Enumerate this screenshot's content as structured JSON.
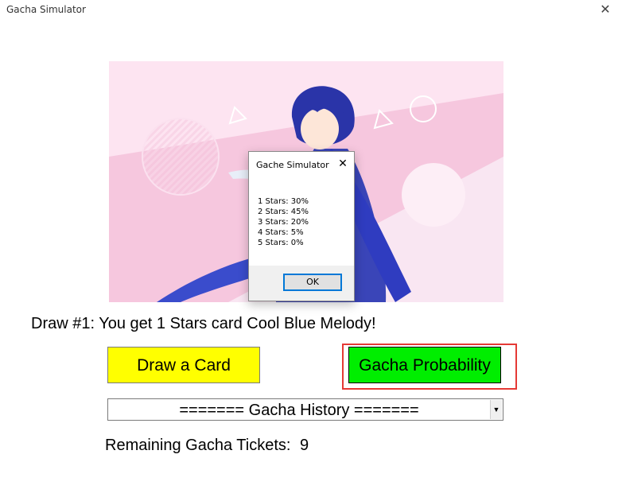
{
  "window": {
    "title": "Gacha Simulator",
    "close_glyph": "✕"
  },
  "banner": {
    "image": "character-banner-pink-background"
  },
  "dialog": {
    "title": "Gache Simulator",
    "close_glyph": "✕",
    "lines": [
      "1 Stars: 30%",
      "2 Stars: 45%",
      "3 Stars: 20%",
      "4 Stars: 5%",
      "5 Stars: 0%"
    ],
    "ok_label": "OK"
  },
  "main": {
    "draw_result": "Draw #1: You get 1 Stars card Cool Blue Melody!",
    "draw_button_label": "Draw a Card",
    "probability_button_label": "Gacha Probability",
    "history_selected": "======= Gacha History =======",
    "tickets_label": "Remaining Gacha Tickets:",
    "tickets_value": "9"
  },
  "colors": {
    "draw_button": "#ffff00",
    "probability_button": "#00ee00",
    "highlight": "#e53935"
  }
}
